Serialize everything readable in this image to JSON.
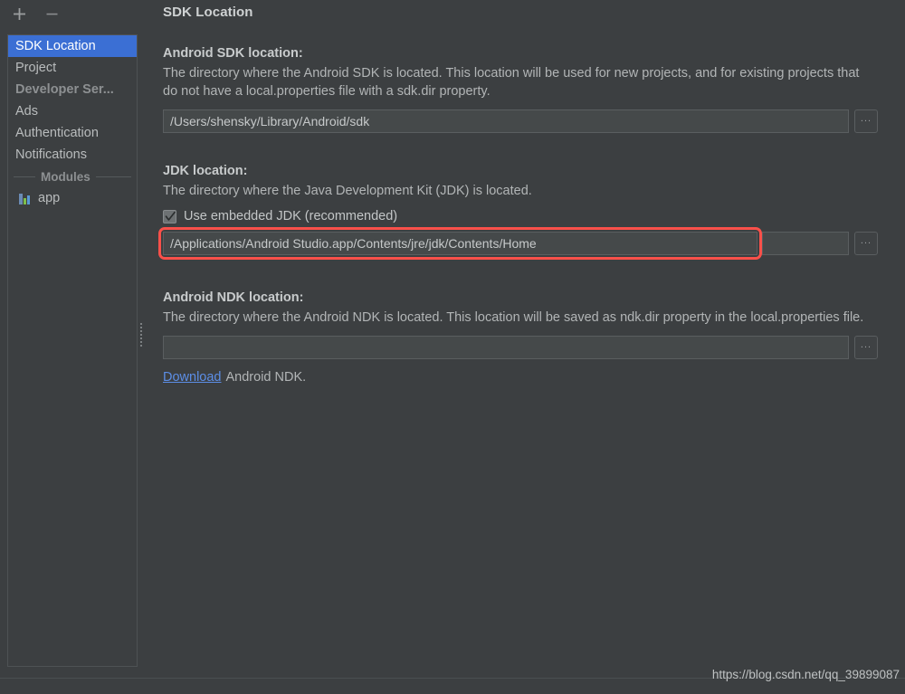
{
  "window": {
    "title": "SDK Location"
  },
  "sidebar": {
    "toolbar": {
      "add_label": "+",
      "remove_label": "−"
    },
    "items": [
      {
        "label": "SDK Location",
        "selected": true,
        "type": "item"
      },
      {
        "label": "Project",
        "selected": false,
        "type": "item"
      },
      {
        "label": "Developer Ser...",
        "selected": false,
        "type": "group-title"
      },
      {
        "label": "Ads",
        "selected": false,
        "type": "item"
      },
      {
        "label": "Authentication",
        "selected": false,
        "type": "item"
      },
      {
        "label": "Notifications",
        "selected": false,
        "type": "item"
      }
    ],
    "modules_separator_label": "Modules",
    "modules": [
      {
        "label": "app",
        "icon": "android-module-icon"
      }
    ]
  },
  "main": {
    "title": "SDK Location",
    "sdk": {
      "label": "Android SDK location:",
      "description": "The directory where the Android SDK is located. This location will be used for new projects, and for existing projects that do not have a local.properties file with a sdk.dir property.",
      "value": "/Users/shensky/Library/Android/sdk",
      "placeholder": "",
      "browse_label": "..."
    },
    "jdk": {
      "label": "JDK location:",
      "description": "The directory where the Java Development Kit (JDK) is located.",
      "checkbox_label": "Use embedded JDK (recommended)",
      "checkbox_checked": true,
      "value": "/Applications/Android Studio.app/Contents/jre/jdk/Contents/Home",
      "placeholder": "",
      "browse_label": "...",
      "highlight_color": "#f9504a"
    },
    "ndk": {
      "label": "Android NDK location:",
      "description": "The directory where the Android NDK is located. This location will be saved as ndk.dir property in the local.properties file.",
      "value": "",
      "placeholder": "",
      "browse_label": "...",
      "download_link_label": "Download",
      "download_suffix": "Android NDK."
    }
  },
  "footer": {
    "watermark": "https://blog.csdn.net/qq_39899087"
  },
  "colors": {
    "background": "#3c3f41",
    "selection_blue": "#3b6fd4",
    "link_blue": "#5c8ee6",
    "highlight_red": "#f9504a",
    "field_background": "#45494a"
  }
}
